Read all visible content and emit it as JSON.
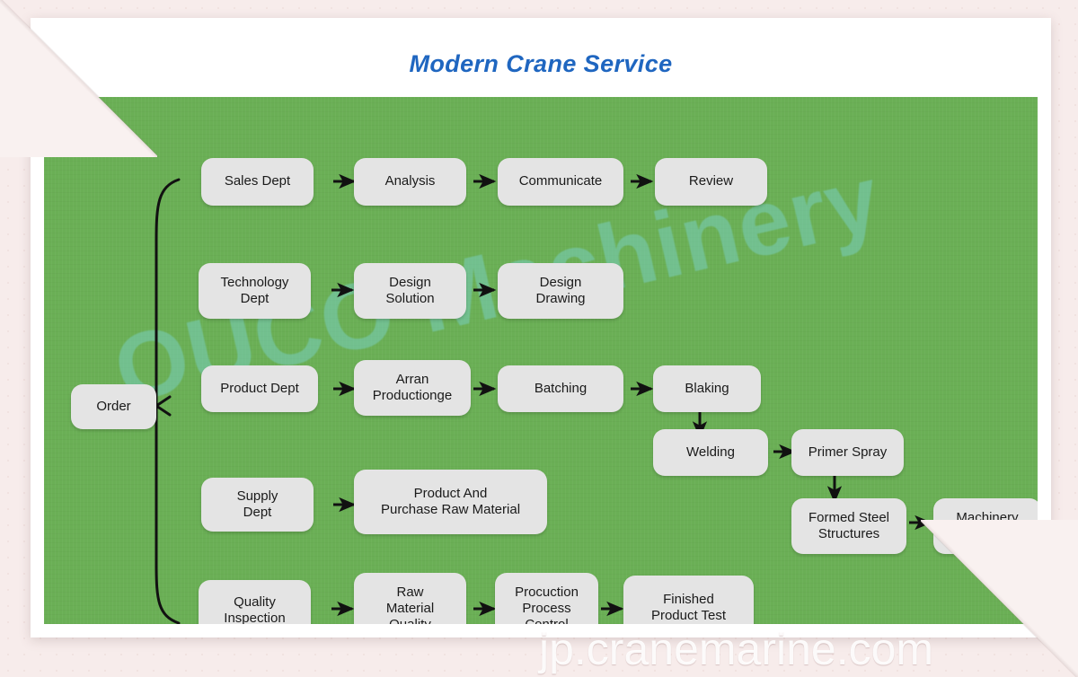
{
  "page": {
    "title": "Modern Crane Service",
    "title_color": "#1f66c0",
    "board_color": "#6aaf55",
    "node_color": "#e4e4e4",
    "background_color": "#f7eceb"
  },
  "watermarks": {
    "brand": "OUCO Machinery",
    "brand_color": "#78cdbe",
    "domain": "jp.cranemarine.com",
    "domain_color": "#ffffff"
  },
  "flow": {
    "entry": {
      "label": "Order"
    },
    "rows": [
      {
        "name": "sales-row",
        "nodes": [
          {
            "label": "Sales Dept"
          },
          {
            "label": "Analysis"
          },
          {
            "label": "Communicate"
          },
          {
            "label": "Review"
          }
        ]
      },
      {
        "name": "technology-row",
        "nodes": [
          {
            "label": "Technology\nDept"
          },
          {
            "label": "Design\nSolution"
          },
          {
            "label": "Design\nDrawing"
          }
        ]
      },
      {
        "name": "production-row",
        "nodes": [
          {
            "label": "Product Dept"
          },
          {
            "label": "Arran\nProductionge"
          },
          {
            "label": "Batching"
          },
          {
            "label": "Blaking"
          },
          {
            "label": "Welding"
          },
          {
            "label": "Primer Spray"
          },
          {
            "label": "Formed Steel\nStructures"
          },
          {
            "label": "Machinery\nFitting"
          }
        ]
      },
      {
        "name": "supply-row",
        "nodes": [
          {
            "label": "Supply\nDept"
          },
          {
            "label": "Product And\nPurchase Raw Material"
          }
        ]
      },
      {
        "name": "quality-row",
        "nodes": [
          {
            "label": "Quality\nInspection"
          },
          {
            "label": "Raw\nMaterial\nQuality"
          },
          {
            "label": "Procuction\nProcess\nControl"
          },
          {
            "label": "Finished\nProduct Test"
          }
        ]
      }
    ]
  }
}
